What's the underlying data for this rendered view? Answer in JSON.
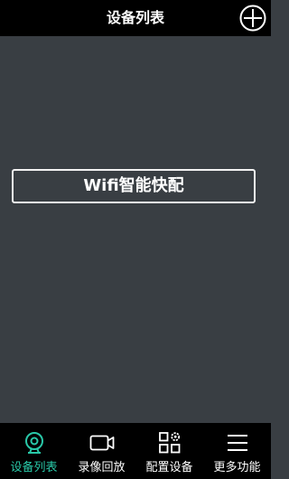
{
  "header": {
    "title": "设备列表",
    "add_icon": "plus-circle-icon"
  },
  "main": {
    "wifi_button_label": "Wifi智能快配"
  },
  "tabbar": {
    "active_color": "#29c8a8",
    "tabs": [
      {
        "label": "设备列表",
        "icon": "camera-icon",
        "active": true
      },
      {
        "label": "录像回放",
        "icon": "video-icon",
        "active": false
      },
      {
        "label": "配置设备",
        "icon": "grid-gear-icon",
        "active": false
      },
      {
        "label": "更多功能",
        "icon": "menu-icon",
        "active": false
      }
    ]
  }
}
